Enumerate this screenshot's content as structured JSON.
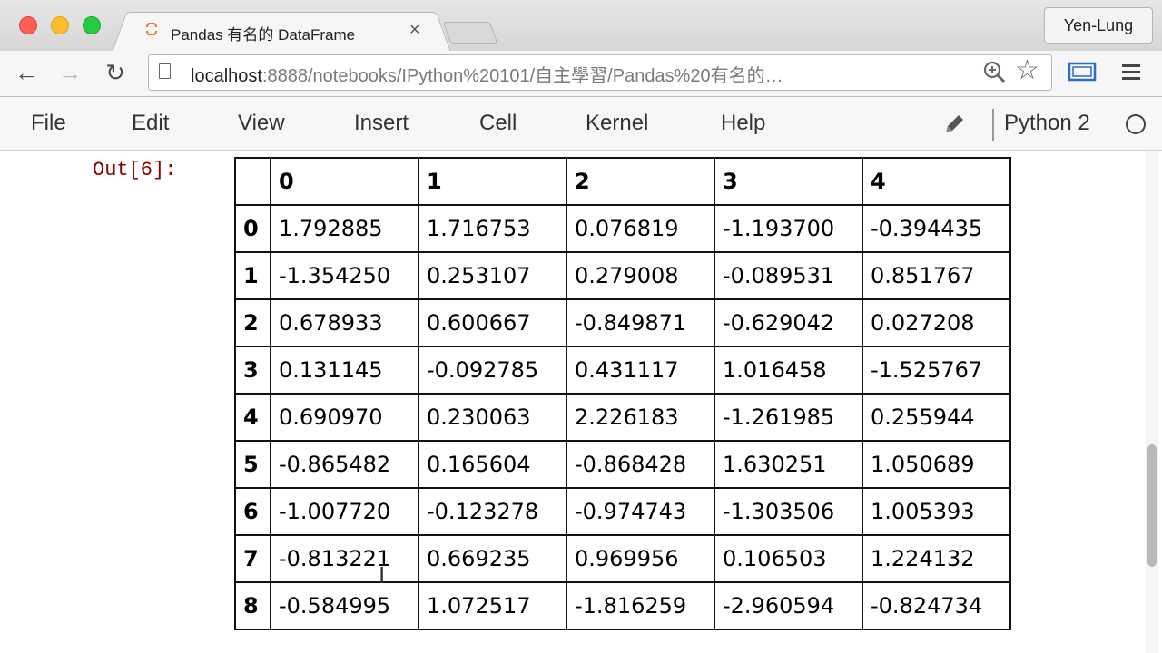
{
  "browser": {
    "tab_title": "Pandas 有名的 DataFrame",
    "tab_close": "×",
    "profile_name": "Yen-Lung",
    "url_host": "localhost",
    "url_rest": ":8888/notebooks/IPython%20101/自主學習/Pandas%20有名的…",
    "back_glyph": "←",
    "forward_glyph": "→",
    "reload_glyph": "↻",
    "star_glyph": "☆",
    "icons": [
      "back-arrow-icon",
      "forward-arrow-icon",
      "reload-icon",
      "page-icon",
      "zoom-icon",
      "star-icon",
      "cast-icon",
      "menu-icon"
    ]
  },
  "notebook": {
    "menu": [
      "File",
      "Edit",
      "View",
      "Insert",
      "Cell",
      "Kernel",
      "Help"
    ],
    "kernel_name": "Python 2",
    "out_prompt": "Out[6]:"
  },
  "dataframe": {
    "columns": [
      "0",
      "1",
      "2",
      "3",
      "4"
    ],
    "index": [
      "0",
      "1",
      "2",
      "3",
      "4",
      "5",
      "6",
      "7",
      "8"
    ],
    "rows": [
      [
        "1.792885",
        "1.716753",
        "0.076819",
        "-1.193700",
        "-0.394435"
      ],
      [
        "-1.354250",
        "0.253107",
        "0.279008",
        "-0.089531",
        "0.851767"
      ],
      [
        "0.678933",
        "0.600667",
        "-0.849871",
        "-0.629042",
        "0.027208"
      ],
      [
        "0.131145",
        "-0.092785",
        "0.431117",
        "1.016458",
        "-1.525767"
      ],
      [
        "0.690970",
        "0.230063",
        "2.226183",
        "-1.261985",
        "0.255944"
      ],
      [
        "-0.865482",
        "0.165604",
        "-0.868428",
        "1.630251",
        "1.050689"
      ],
      [
        "-1.007720",
        "-0.123278",
        "-0.974743",
        "-1.303506",
        "1.005393"
      ],
      [
        "-0.813221",
        "0.669235",
        "0.969956",
        "0.106503",
        "1.224132"
      ],
      [
        "-0.584995",
        "1.072517",
        "-1.816259",
        "-2.960594",
        "-0.824734"
      ]
    ]
  },
  "colors": {
    "out_prompt": "#8b0000",
    "close_red": "#fd5f57",
    "minimize_yellow": "#febc2e",
    "zoom_green": "#28c840"
  }
}
